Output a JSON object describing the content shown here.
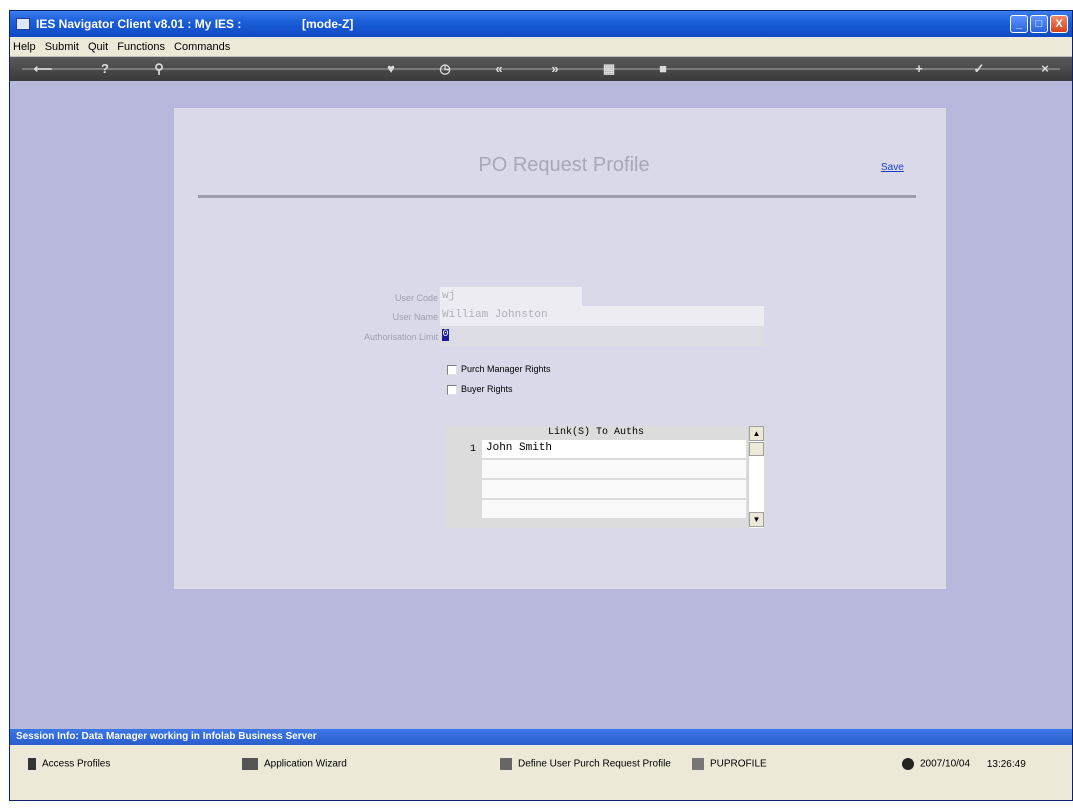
{
  "window": {
    "title": "IES Navigator Client v8.01 : My IES :",
    "mode": "[mode-Z]",
    "minimize": "_",
    "maximize": "□",
    "close": "X"
  },
  "menu": [
    "Help",
    "Submit",
    "Quit",
    "Functions",
    "Commands"
  ],
  "toolbar": {
    "back": "⟵",
    "help": "?",
    "search": "⚲",
    "heart": "♥",
    "clock": "◷",
    "prev": "«",
    "next": "»",
    "grid": "▦",
    "stop": "■",
    "add": "+",
    "ok": "✓",
    "cancel": "×"
  },
  "form": {
    "title": "PO Request Profile",
    "save": "Save",
    "user_code_label": "User Code",
    "user_code_value": "wj",
    "user_name_label": "User Name",
    "user_name_value": "William Johnston",
    "auth_limit_label": "Authorisation Limit",
    "auth_limit_value": "0",
    "purch_manager_label": "Purch Manager Rights",
    "buyer_rights_label": "Buyer Rights",
    "purch_manager_checked": false,
    "buyer_rights_checked": false
  },
  "grid": {
    "header": "Link(S) To Auths",
    "rows": [
      {
        "num": "1",
        "value": "John Smith"
      }
    ],
    "scroll_up": "▲",
    "scroll_down": "▼"
  },
  "status": {
    "session_info": "Session Info: Data Manager working in Infolab Business Server"
  },
  "taskbar": {
    "access_profiles": "Access Profiles",
    "application_wizard": "Application Wizard",
    "define_profile": "Define User Purch Request Profile",
    "puprofile": "PUPROFILE",
    "date": "2007/10/04",
    "time": "13:26:49"
  }
}
